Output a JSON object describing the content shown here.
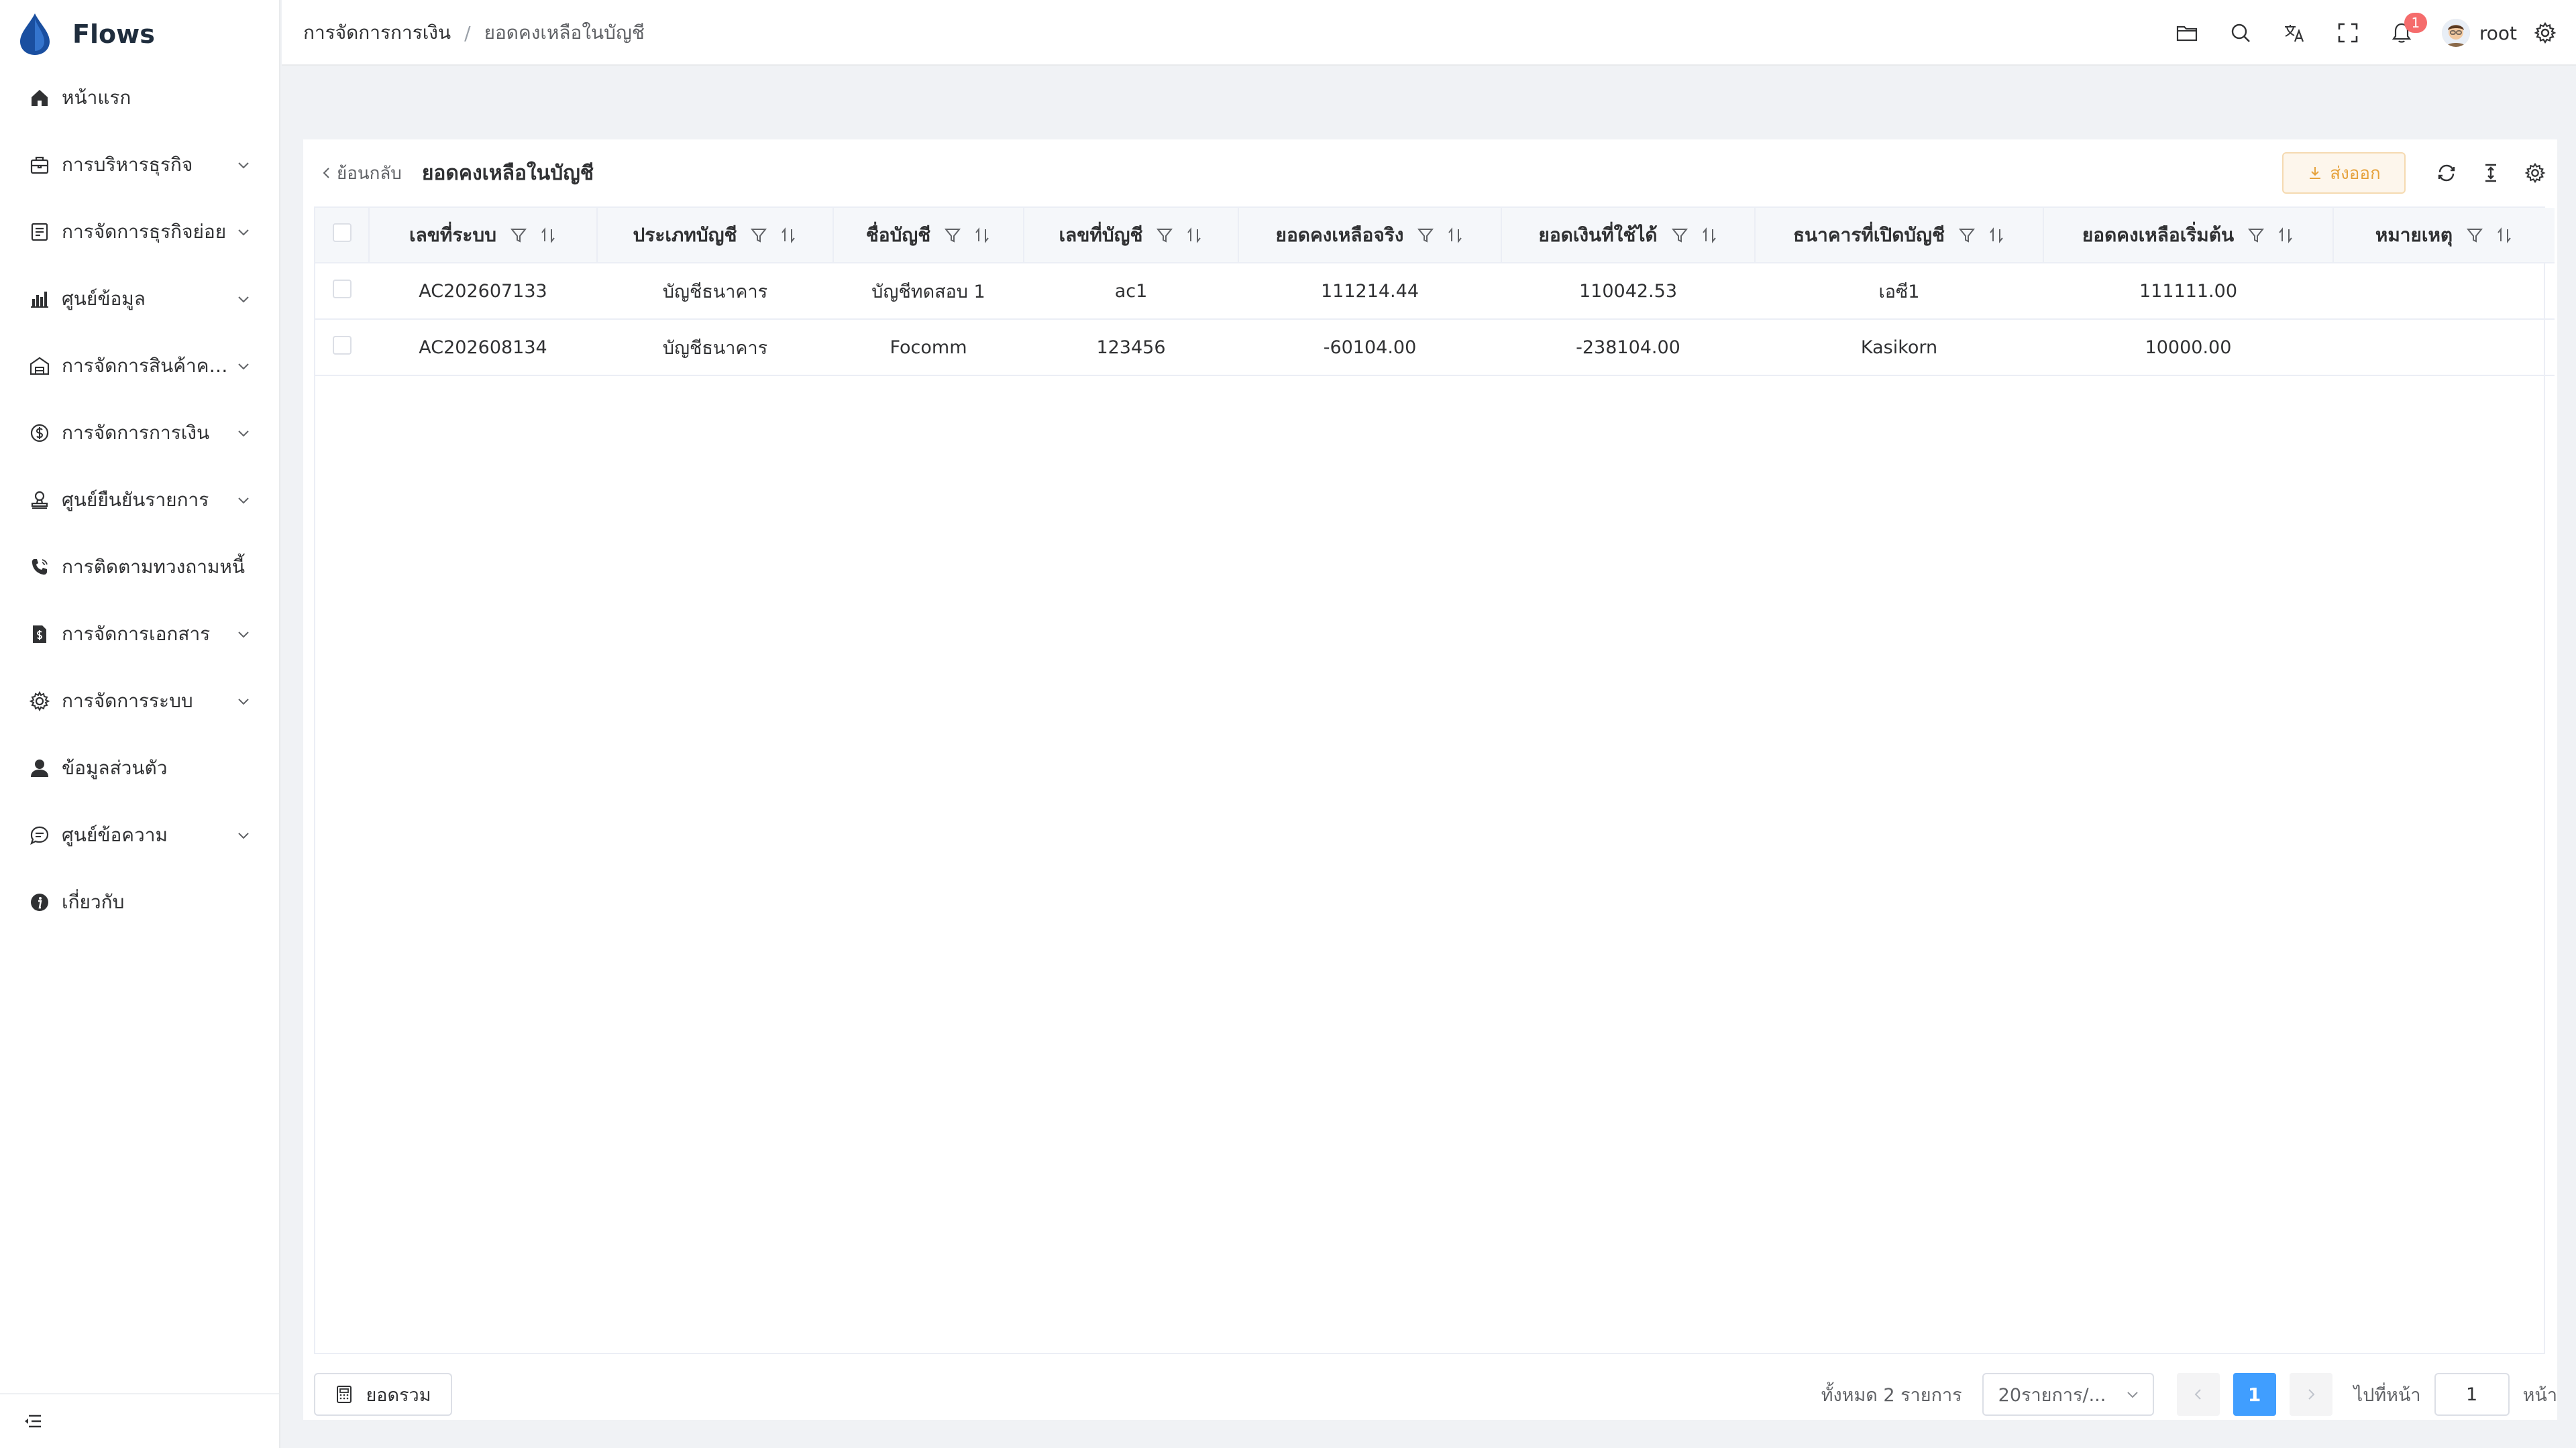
{
  "app": {
    "name": "Flows"
  },
  "sidebar": {
    "items": [
      {
        "label": "หน้าแรก",
        "icon": "home-icon",
        "expandable": false
      },
      {
        "label": "การบริหารธุรกิจ",
        "icon": "briefcase-icon",
        "expandable": true
      },
      {
        "label": "การจัดการธุรกิจย่อย",
        "icon": "form-icon",
        "expandable": true
      },
      {
        "label": "ศูนย์ข้อมูล",
        "icon": "bar-chart-icon",
        "expandable": true
      },
      {
        "label": "การจัดการสินค้าคง...",
        "icon": "warehouse-icon",
        "expandable": true
      },
      {
        "label": "การจัดการการเงิน",
        "icon": "money-icon",
        "expandable": true
      },
      {
        "label": "ศูนย์ยืนยันรายการ",
        "icon": "stamp-icon",
        "expandable": true
      },
      {
        "label": "การติดตามทวงถามหนี้",
        "icon": "phone-icon",
        "expandable": false
      },
      {
        "label": "การจัดการเอกสาร",
        "icon": "document-icon",
        "expandable": true
      },
      {
        "label": "การจัดการระบบ",
        "icon": "gear-icon",
        "expandable": true
      },
      {
        "label": "ข้อมูลส่วนตัว",
        "icon": "user-icon",
        "expandable": false
      },
      {
        "label": "ศูนย์ข้อความ",
        "icon": "message-icon",
        "expandable": true
      },
      {
        "label": "เกี่ยวกับ",
        "icon": "info-icon",
        "expandable": false
      }
    ]
  },
  "header": {
    "breadcrumb": [
      "การจัดการการเงิน",
      "ยอดคงเหลือในบัญชี"
    ],
    "separator": "/",
    "notification_count": "1",
    "username": "root"
  },
  "page": {
    "back_label": "ย้อนกลับ",
    "title": "ยอดคงเหลือในบัญชี",
    "export_label": "ส่งออก"
  },
  "table": {
    "columns": [
      "เลขที่ระบบ",
      "ประเภทบัญชี",
      "ชื่อบัญชี",
      "เลขที่บัญชี",
      "ยอดคงเหลือจริง",
      "ยอดเงินที่ใช้ได้",
      "ธนาคารที่เปิดบัญชี",
      "ยอดคงเหลือเริ่มต้น",
      "หมายเหตุ"
    ],
    "rows": [
      [
        "AC202607133",
        "บัญชีธนาคาร",
        "บัญชีทดสอบ 1",
        "ac1",
        "111214.44",
        "110042.53",
        "เอซี1",
        "111111.00",
        ""
      ],
      [
        "AC202608134",
        "บัญชีธนาคาร",
        "Focomm",
        "123456",
        "-60104.00",
        "-238104.00",
        "Kasikorn",
        "10000.00",
        ""
      ]
    ]
  },
  "footer": {
    "summary_label": "ยอดรวม",
    "total_text": "ทั้งหมด 2 รายการ",
    "page_size": "20รายการ/...",
    "current_page": "1",
    "goto_label": "ไปที่หน้า",
    "goto_value": "1",
    "goto_suffix": "หน้า"
  },
  "colors": {
    "primary": "#409eff",
    "warning": "#e6a23c",
    "danger": "#f56c6c",
    "logo": "#1a4fa0"
  }
}
